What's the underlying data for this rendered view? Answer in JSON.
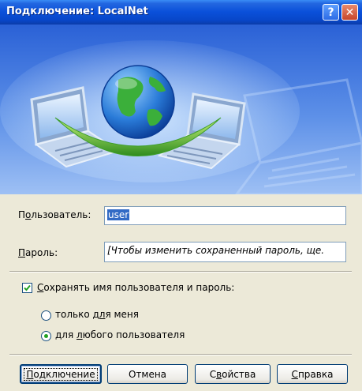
{
  "window": {
    "title": "Подключение: LocalNet",
    "help_icon": "?",
    "close_icon": "✕"
  },
  "form": {
    "user": {
      "label_pre": "П",
      "label_u": "о",
      "label_post": "льзователь:",
      "value": "user"
    },
    "password": {
      "label_pre": "",
      "label_u": "П",
      "label_post": "ароль:",
      "value": "[Чтобы изменить сохраненный пароль, ще."
    }
  },
  "save": {
    "checked": true,
    "label_u": "С",
    "label_post": "охранять имя пользователя и пароль:"
  },
  "radios": [
    {
      "pre": "только д",
      "u": "л",
      "post": "я меня",
      "selected": false
    },
    {
      "pre": "для ",
      "u": "л",
      "post": "юбого пользователя",
      "selected": true
    }
  ],
  "buttons": {
    "connect": {
      "u": "П",
      "post": "одключение"
    },
    "cancel": {
      "label": "Отмена"
    },
    "properties": {
      "pre": "С",
      "u": "в",
      "post": "ойства"
    },
    "help": {
      "u": "С",
      "post": "правка"
    }
  }
}
